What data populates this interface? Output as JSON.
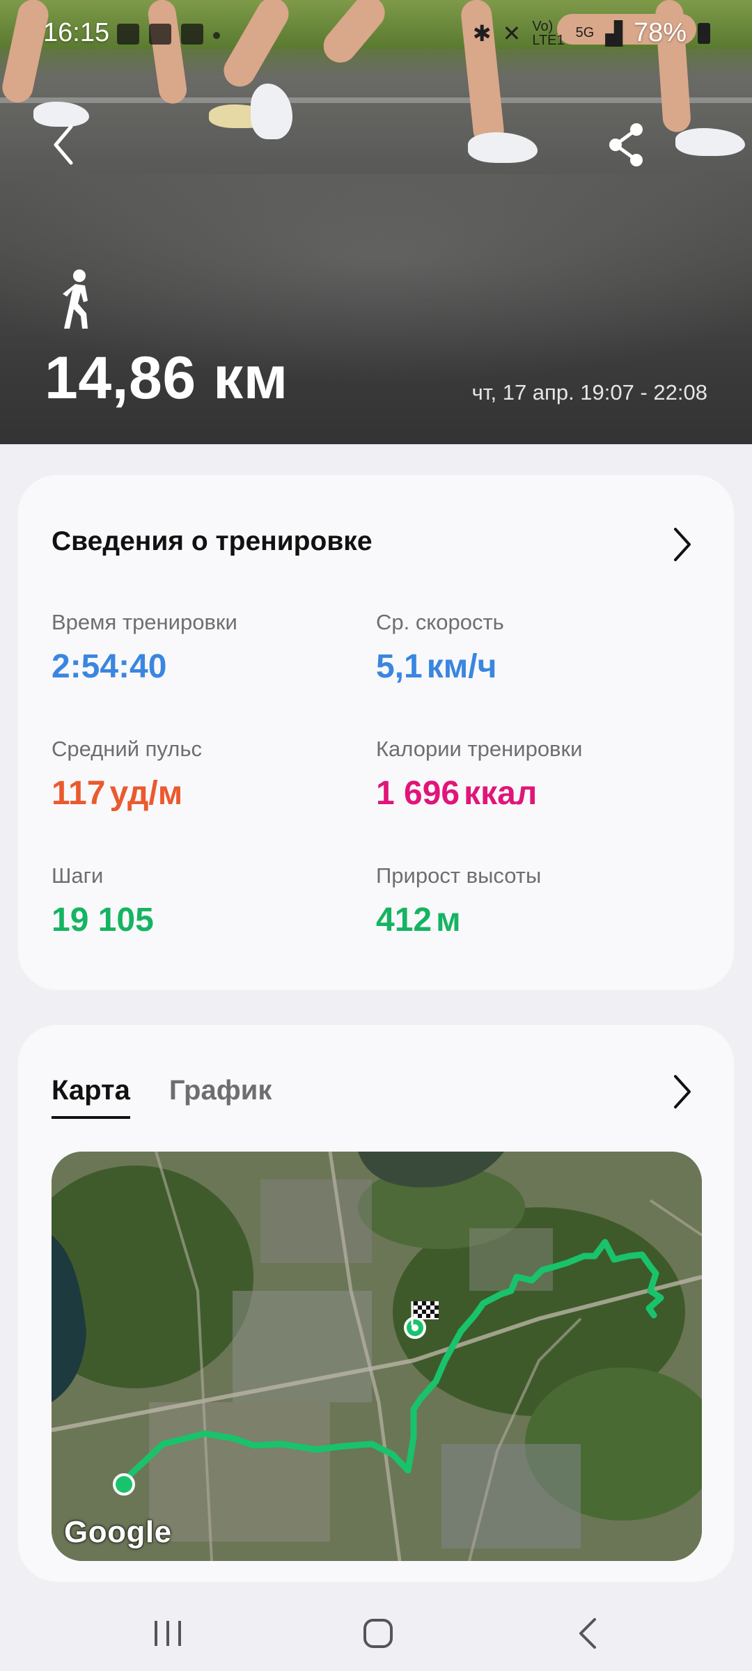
{
  "status_bar": {
    "time": "16:15",
    "battery": "78%",
    "network": "5G",
    "icons": [
      "gmail-icon",
      "checkbox-icon",
      "youtube-icon",
      "bluetooth-icon",
      "mute-icon",
      "volte-icon",
      "signal-icon",
      "battery-icon"
    ]
  },
  "header": {
    "activity_icon": "walking-person-icon",
    "distance": "14,86 км",
    "datetime": "чт, 17 апр. 19:07 - 22:08",
    "back_icon": "chevron-left-icon",
    "share_icon": "share-icon"
  },
  "workout": {
    "title": "Сведения о тренировке",
    "stats": [
      {
        "label": "Время тренировки",
        "value": "2:54:40",
        "unit": "",
        "color": "#3a86e0"
      },
      {
        "label": "Ср. скорость",
        "value": "5,1",
        "unit": "км/ч",
        "color": "#3a86e0"
      },
      {
        "label": "Средний пульс",
        "value": "117",
        "unit": "уд/м",
        "color": "#ea5a2e"
      },
      {
        "label": "Калории тренировки",
        "value": "1 696",
        "unit": "ккал",
        "color": "#e0157a"
      },
      {
        "label": "Шаги",
        "value": "19 105",
        "unit": "",
        "color": "#16b462"
      },
      {
        "label": "Прирост высоты",
        "value": "412",
        "unit": "м",
        "color": "#16b462"
      }
    ]
  },
  "map_card": {
    "tabs": [
      {
        "label": "Карта",
        "active": true
      },
      {
        "label": "График",
        "active": false
      }
    ],
    "map_attribution": "Google",
    "route_color": "#19c36b"
  },
  "nav_bar": {
    "buttons": [
      "recent-apps-icon",
      "home-icon",
      "back-icon"
    ]
  }
}
